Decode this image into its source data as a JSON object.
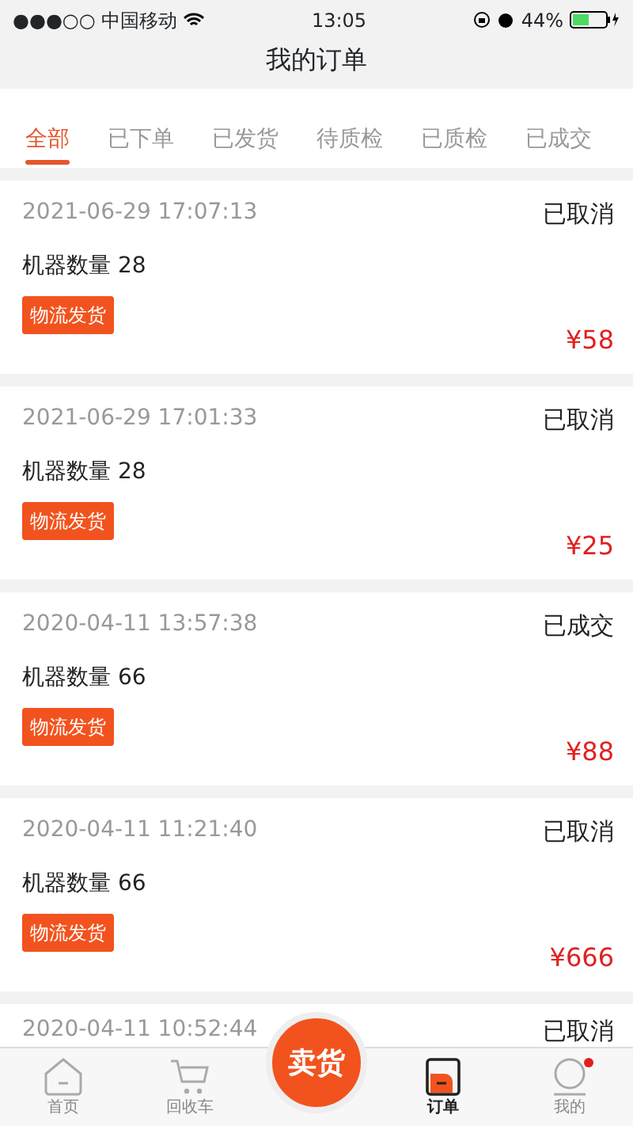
{
  "status_bar": {
    "carrier": "●●●○○ 中国移动",
    "time": "13:05",
    "battery": "44%"
  },
  "title": "我的订单",
  "tabs": [
    {
      "label": "全部",
      "selected": true
    },
    {
      "label": "已下单",
      "selected": false
    },
    {
      "label": "已发货",
      "selected": false
    },
    {
      "label": "待质检",
      "selected": false
    },
    {
      "label": "已质检",
      "selected": false
    },
    {
      "label": "已成交",
      "selected": false
    }
  ],
  "orders": [
    {
      "time": "2021-06-29 17:07:13",
      "status": "已取消",
      "quantity": "机器数量 28",
      "tag": "物流发货",
      "price": "¥58"
    },
    {
      "time": "2021-06-29 17:01:33",
      "status": "已取消",
      "quantity": "机器数量 28",
      "tag": "物流发货",
      "price": "¥25"
    },
    {
      "time": "2020-04-11 13:57:38",
      "status": "已成交",
      "quantity": "机器数量 66",
      "tag": "物流发货",
      "price": "¥88"
    },
    {
      "time": "2020-04-11 11:21:40",
      "status": "已取消",
      "quantity": "机器数量 66",
      "tag": "物流发货",
      "price": "¥666"
    },
    {
      "time": "2020-04-11 10:52:44",
      "status": "已取消"
    }
  ],
  "tab_bar": [
    {
      "kind": "home",
      "label": "首页",
      "selected": false
    },
    {
      "kind": "cart",
      "label": "回收车",
      "selected": false
    },
    {
      "kind": "sell",
      "label": "卖货"
    },
    {
      "kind": "orders",
      "label": "订单",
      "selected": true
    },
    {
      "kind": "me",
      "label": "我的",
      "selected": false,
      "badge": true
    }
  ]
}
